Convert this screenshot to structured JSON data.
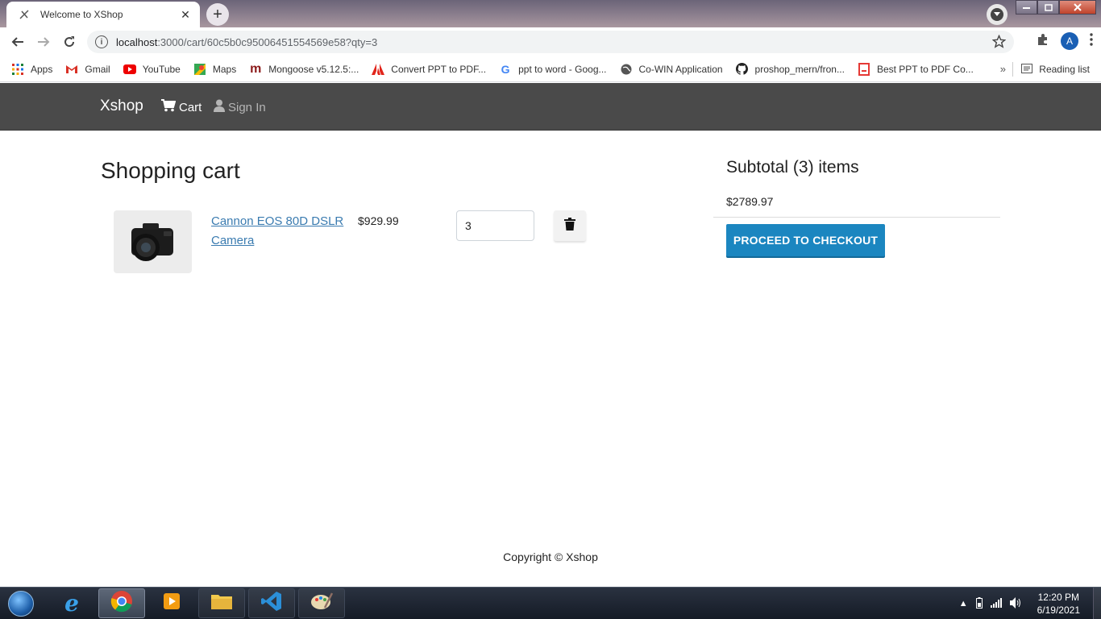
{
  "browser": {
    "tab_title": "Welcome to XShop",
    "new_tab_symbol": "+",
    "url_host": "localhost",
    "url_rest": ":3000/cart/60c5b0c95006451554569e58?qty=3",
    "profile_initial": "A"
  },
  "bookmarks": {
    "items": [
      {
        "label": "Apps",
        "icon": "apps-grid-icon"
      },
      {
        "label": "Gmail",
        "icon": "gmail-icon"
      },
      {
        "label": "YouTube",
        "icon": "youtube-icon"
      },
      {
        "label": "Maps",
        "icon": "maps-icon"
      },
      {
        "label": "Mongoose v5.12.5:...",
        "icon": "mongoose-icon"
      },
      {
        "label": "Convert PPT to PDF...",
        "icon": "adobe-icon"
      },
      {
        "label": "ppt to word - Goog...",
        "icon": "google-icon"
      },
      {
        "label": "Co-WIN Application",
        "icon": "globe-icon"
      },
      {
        "label": "proshop_mern/fron...",
        "icon": "github-icon"
      },
      {
        "label": "Best PPT to PDF Co...",
        "icon": "pdf-icon"
      }
    ],
    "overflow": "»",
    "reading_list": "Reading list"
  },
  "navbar": {
    "brand": "Xshop",
    "cart": "Cart",
    "sign_in": "Sign In"
  },
  "cart": {
    "title": "Shopping cart",
    "item": {
      "name": "Cannon EOS 80D DSLR Camera",
      "price": "$929.99",
      "qty": "3"
    }
  },
  "summary": {
    "title": "Subtotal (3) items",
    "total": "$2789.97",
    "checkout": "PROCEED TO CHECKOUT"
  },
  "footer": {
    "text": "Copyright © Xshop"
  },
  "taskbar": {
    "time": "12:20 PM",
    "date": "6/19/2021"
  }
}
